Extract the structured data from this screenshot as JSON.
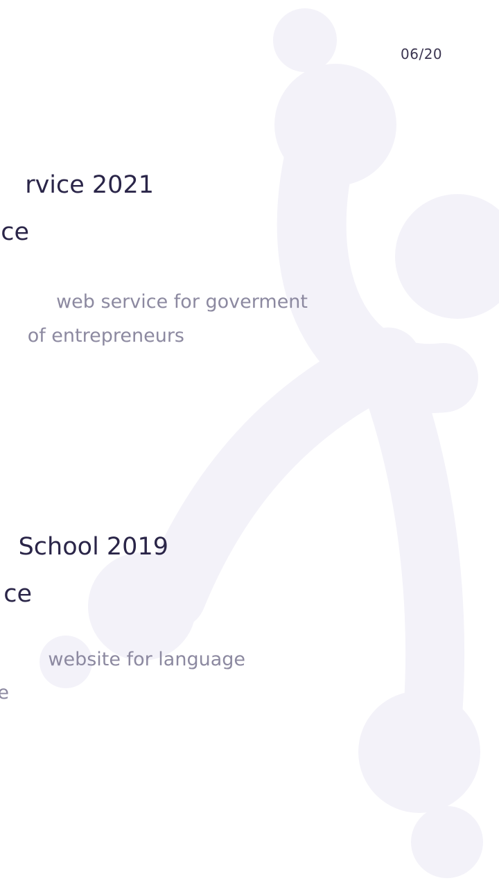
{
  "page_number": "06/20",
  "projects": [
    {
      "title": "rvice 2021",
      "subtitle": "ce",
      "description_line1": "web service for goverment",
      "description_line2": "of entrepreneurs"
    },
    {
      "title": "School 2019",
      "subtitle": "ce",
      "description_line1": "website for language",
      "description_line2": "e"
    }
  ],
  "colors": {
    "background": "#ffffff",
    "figure": "#f3f2f9",
    "title": "#2a2548",
    "description": "#8c89a0",
    "page_number": "#3b3550"
  }
}
